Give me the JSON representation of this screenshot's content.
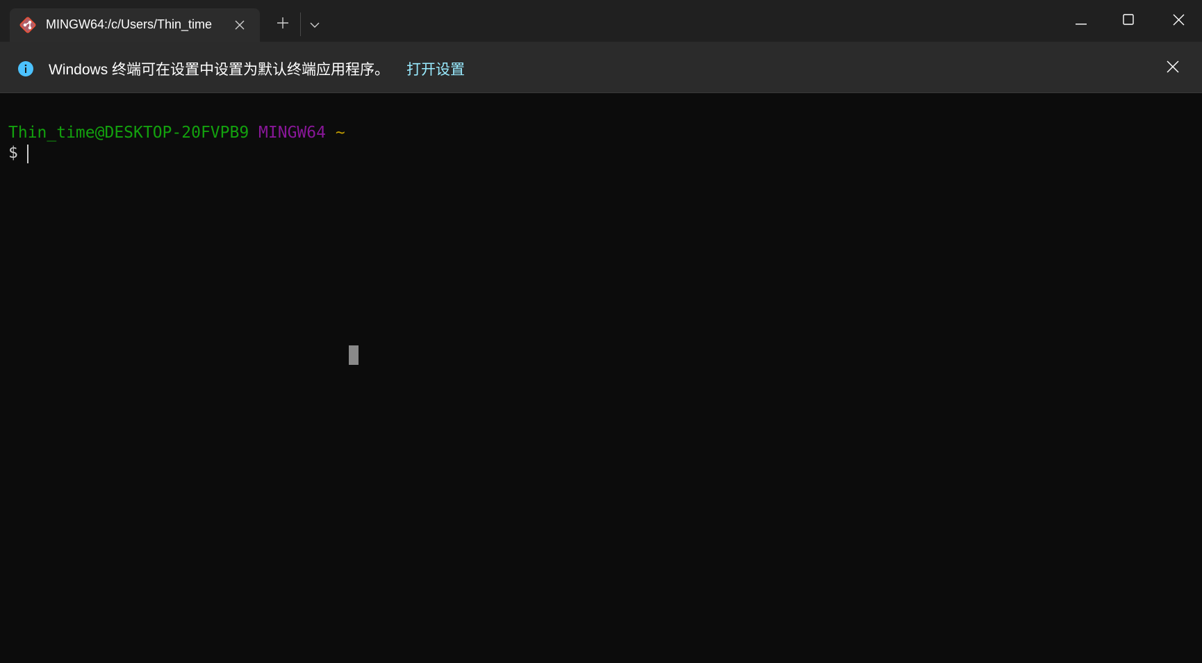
{
  "window": {
    "tab": {
      "title": "MINGW64:/c/Users/Thin_time",
      "icon": "git-bash-icon",
      "close_icon": "close-icon"
    },
    "new_tab_icon": "plus-icon",
    "dropdown_icon": "chevron-down-icon",
    "controls": {
      "minimize_icon": "minimize-icon",
      "maximize_icon": "maximize-icon",
      "close_icon": "close-icon"
    }
  },
  "infobar": {
    "icon": "info-icon",
    "message": "Windows 终端可在设置中设置为默认终端应用程序。",
    "link": "打开设置",
    "close_icon": "close-icon"
  },
  "terminal": {
    "prompt": {
      "user_host": "Thin_time@DESKTOP-20FVPB9",
      "system": "MINGW64",
      "directory": "~"
    },
    "input_prefix": "$ "
  },
  "colors": {
    "background": "#0c0c0c",
    "titlebar": "#202020",
    "tab": "#2c2c2c",
    "infobar": "#2b2b2b",
    "info_icon": "#4cc2ff",
    "link": "#99ebff",
    "user_host": "#13a10e",
    "system": "#881798",
    "directory": "#c19c00"
  }
}
